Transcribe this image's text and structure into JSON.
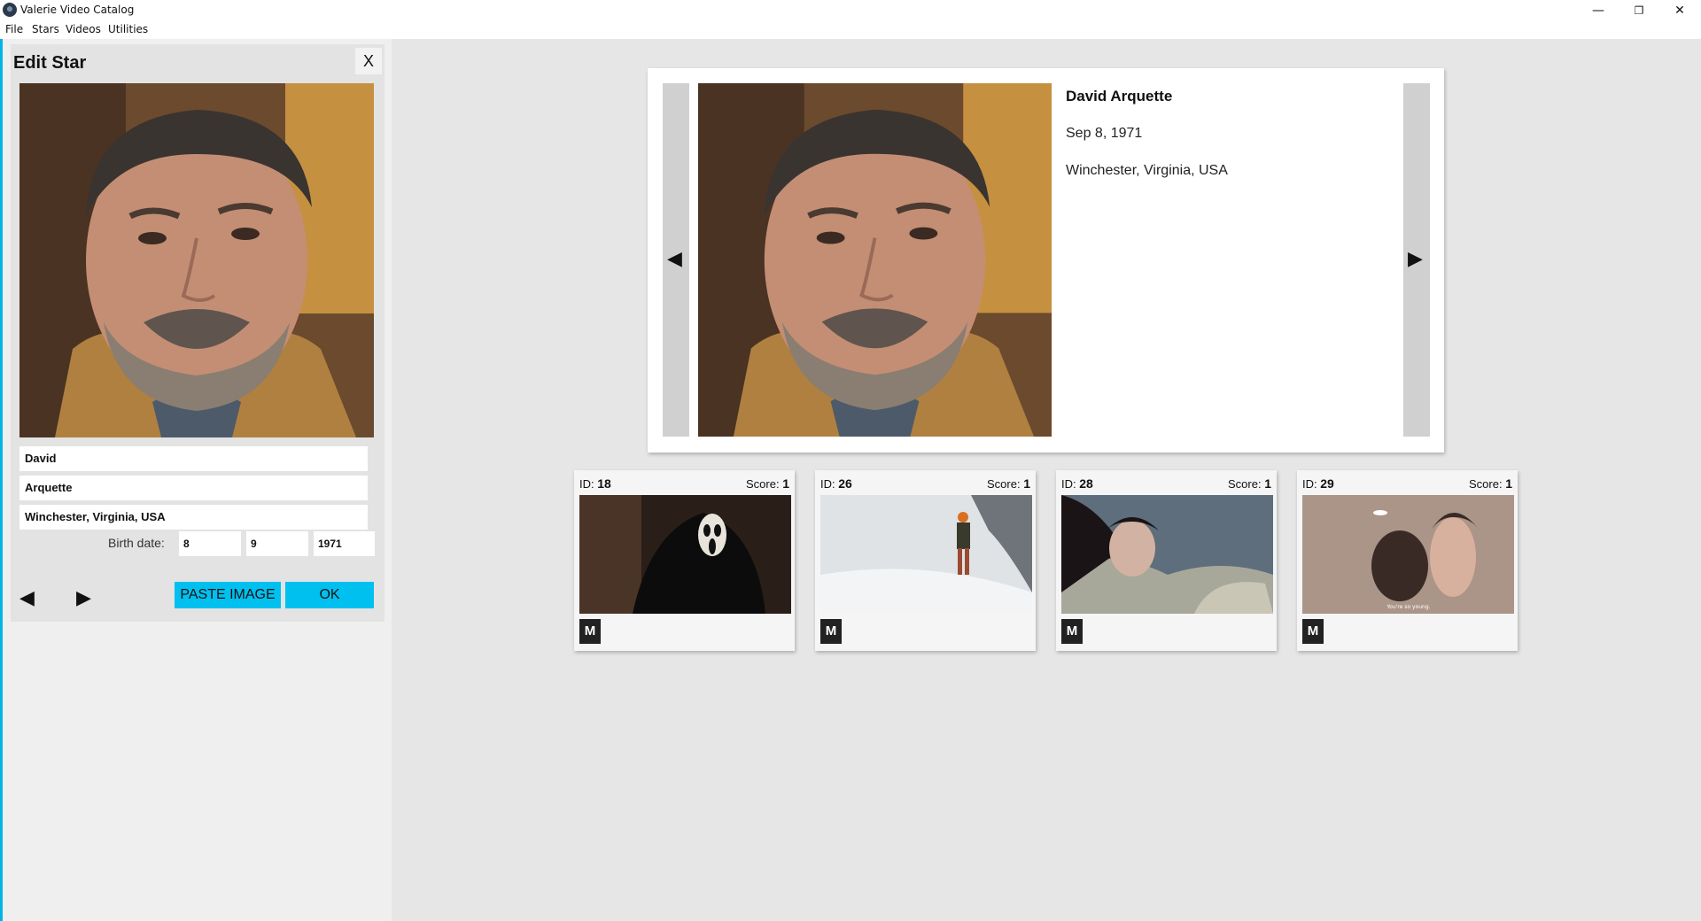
{
  "window": {
    "title": "Valerie Video Catalog",
    "minimize": "—",
    "maximize": "❐",
    "close": "✕"
  },
  "menu": [
    "File",
    "Stars",
    "Videos",
    "Utilities"
  ],
  "edit_star": {
    "title": "Edit Star",
    "close_label": "X",
    "first_name": "David",
    "last_name": "Arquette",
    "birth_place": "Winchester, Virginia, USA",
    "birth_date_label": "Birth date:",
    "birth_day": "8",
    "birth_month": "9",
    "birth_year": "1971",
    "prev_arrow": "◀",
    "next_arrow": "▶",
    "paste_image_label": "PASTE IMAGE",
    "ok_label": "OK"
  },
  "star": {
    "name": "David Arquette",
    "birth_date": "Sep 8, 1971",
    "birth_place": "Winchester, Virginia, USA",
    "prev_arrow": "◀",
    "next_arrow": "▶"
  },
  "videos": [
    {
      "id_label": "ID:",
      "id": "18",
      "score_label": "Score:",
      "score": "1",
      "badge": "M"
    },
    {
      "id_label": "ID:",
      "id": "26",
      "score_label": "Score:",
      "score": "1",
      "badge": "M"
    },
    {
      "id_label": "ID:",
      "id": "28",
      "score_label": "Score:",
      "score": "1",
      "badge": "M"
    },
    {
      "id_label": "ID:",
      "id": "29",
      "score_label": "Score:",
      "score": "1",
      "badge": "M",
      "subtitle": "You're so young."
    }
  ],
  "colors": {
    "accent": "#00c0ef",
    "accent_bar": "#00b4e6"
  }
}
